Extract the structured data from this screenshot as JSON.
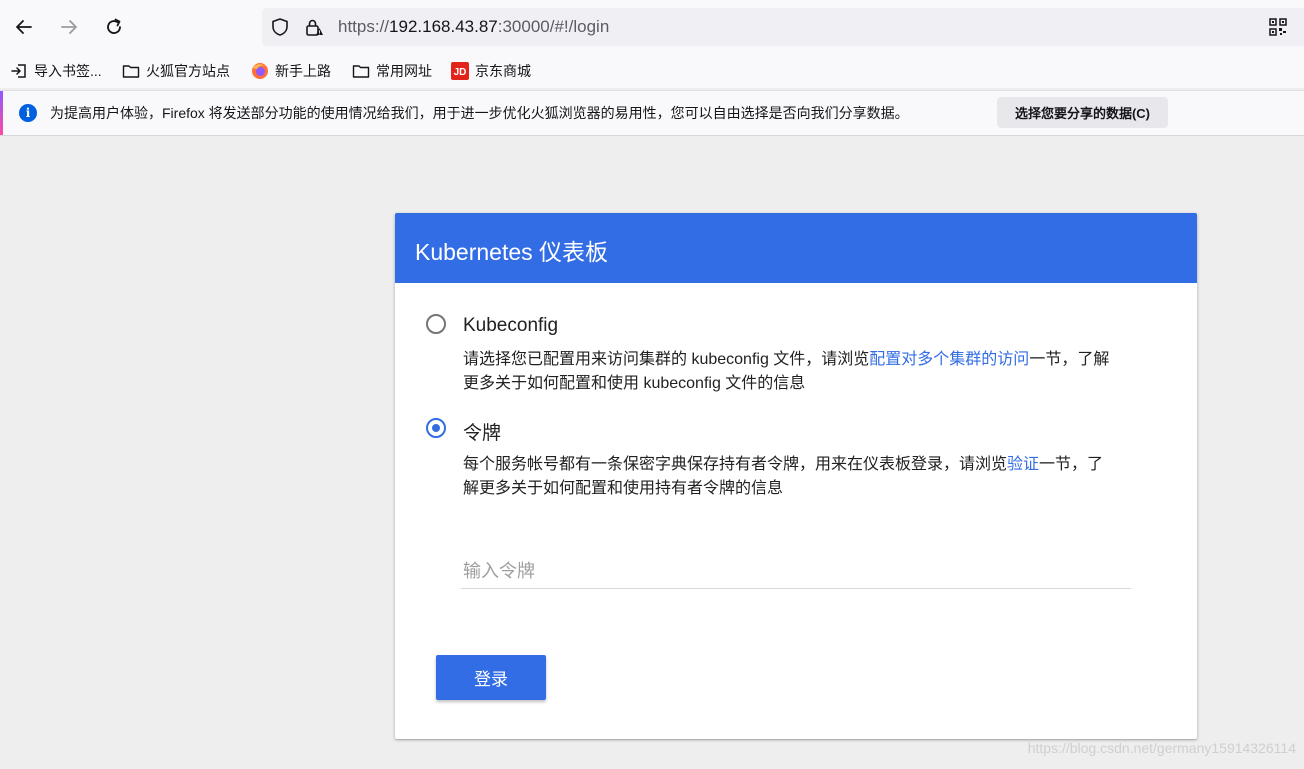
{
  "browser": {
    "url_scheme": "https://",
    "url_host": "192.168.43.87",
    "url_path": ":30000/#!/login",
    "bookmarks": [
      {
        "label": "导入书签...",
        "icon": "import-icon"
      },
      {
        "label": "火狐官方站点",
        "icon": "folder-icon"
      },
      {
        "label": "新手上路",
        "icon": "firefox-icon"
      },
      {
        "label": "常用网址",
        "icon": "folder-icon"
      },
      {
        "label": "京东商城",
        "icon": "jd-logo-icon"
      }
    ],
    "infobar": {
      "message": "为提高用户体验，Firefox 将发送部分功能的使用情况给我们，用于进一步优化火狐浏览器的易用性，您可以自由选择是否向我们分享数据。",
      "button_label": "选择您要分享的数据(C)"
    }
  },
  "login": {
    "title": "Kubernetes 仪表板",
    "options": [
      {
        "label": "Kubeconfig",
        "checked": false,
        "desc_before": "请选择您已配置用来访问集群的 kubeconfig 文件，请浏览",
        "desc_link": "配置对多个集群的访问",
        "desc_after": "一节，了解更多关于如何配置和使用 kubeconfig 文件的信息"
      },
      {
        "label": "令牌",
        "checked": true,
        "desc_before": "每个服务帐号都有一条保密字典保存持有者令牌，用来在仪表板登录，请浏览",
        "desc_link": "验证",
        "desc_after": "一节，了解更多关于如何配置和使用持有者令牌的信息"
      }
    ],
    "token_placeholder": "输入令牌",
    "login_button": "登录"
  },
  "watermark": "https://blog.csdn.net/germany15914326114",
  "colors": {
    "primary": "#326de6",
    "background": "#eeeeee",
    "info_blue": "#0060df"
  }
}
